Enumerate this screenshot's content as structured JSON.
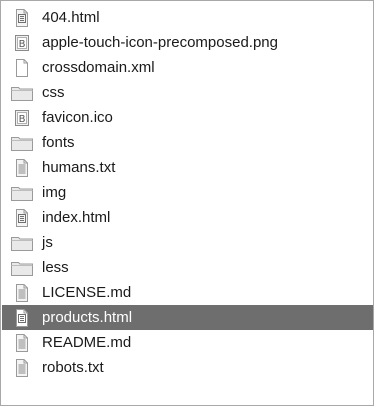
{
  "file_list": {
    "items": [
      {
        "name": "404.html",
        "type": "html",
        "selected": false
      },
      {
        "name": "apple-touch-icon-precomposed.png",
        "type": "image",
        "selected": false
      },
      {
        "name": "crossdomain.xml",
        "type": "blank",
        "selected": false
      },
      {
        "name": "css",
        "type": "folder",
        "selected": false
      },
      {
        "name": "favicon.ico",
        "type": "image",
        "selected": false
      },
      {
        "name": "fonts",
        "type": "folder",
        "selected": false
      },
      {
        "name": "humans.txt",
        "type": "text",
        "selected": false
      },
      {
        "name": "img",
        "type": "folder",
        "selected": false
      },
      {
        "name": "index.html",
        "type": "html",
        "selected": false
      },
      {
        "name": "js",
        "type": "folder",
        "selected": false
      },
      {
        "name": "less",
        "type": "folder",
        "selected": false
      },
      {
        "name": "LICENSE.md",
        "type": "text",
        "selected": false
      },
      {
        "name": "products.html",
        "type": "html",
        "selected": true
      },
      {
        "name": "README.md",
        "type": "text",
        "selected": false
      },
      {
        "name": "robots.txt",
        "type": "text",
        "selected": false
      }
    ]
  },
  "colors": {
    "selection": "#6e6e6e",
    "text": "#1a1a1a",
    "selected_text": "#ffffff",
    "folder_fill": "#e9e9e9",
    "folder_stroke": "#9a9a9a",
    "doc_stroke": "#9a9a9a"
  }
}
